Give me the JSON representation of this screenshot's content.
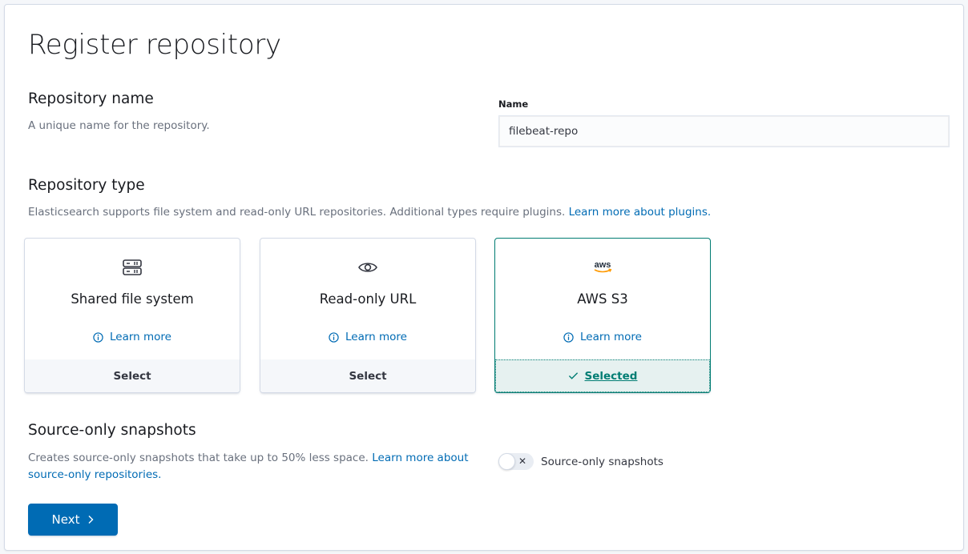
{
  "page": {
    "title": "Register repository"
  },
  "repository_name": {
    "title": "Repository name",
    "description": "A unique name for the repository.",
    "field_label": "Name",
    "value": "filebeat-repo"
  },
  "repository_type": {
    "title": "Repository type",
    "description": "Elasticsearch supports file system and read-only URL repositories. Additional types require plugins.",
    "link": "Learn more about plugins.",
    "cards": [
      {
        "icon": "storage-icon",
        "title": "Shared file system",
        "learn_more": "Learn more",
        "action": "Select",
        "selected": false
      },
      {
        "icon": "eye-icon",
        "title": "Read-only URL",
        "learn_more": "Learn more",
        "action": "Select",
        "selected": false
      },
      {
        "icon": "aws-logo-icon",
        "logo_text": "aws",
        "title": "AWS S3",
        "learn_more": "Learn more",
        "action": "Selected",
        "selected": true
      }
    ]
  },
  "source_only": {
    "title": "Source-only snapshots",
    "description": "Creates source-only snapshots that take up to 50% less space.",
    "link": "Learn more about source-only repositories.",
    "toggle_label": "Source-only snapshots",
    "toggle_on": false
  },
  "actions": {
    "next_label": "Next"
  },
  "colors": {
    "primary": "#006bb4",
    "selected": "#017d73",
    "aws_orange": "#f90"
  }
}
